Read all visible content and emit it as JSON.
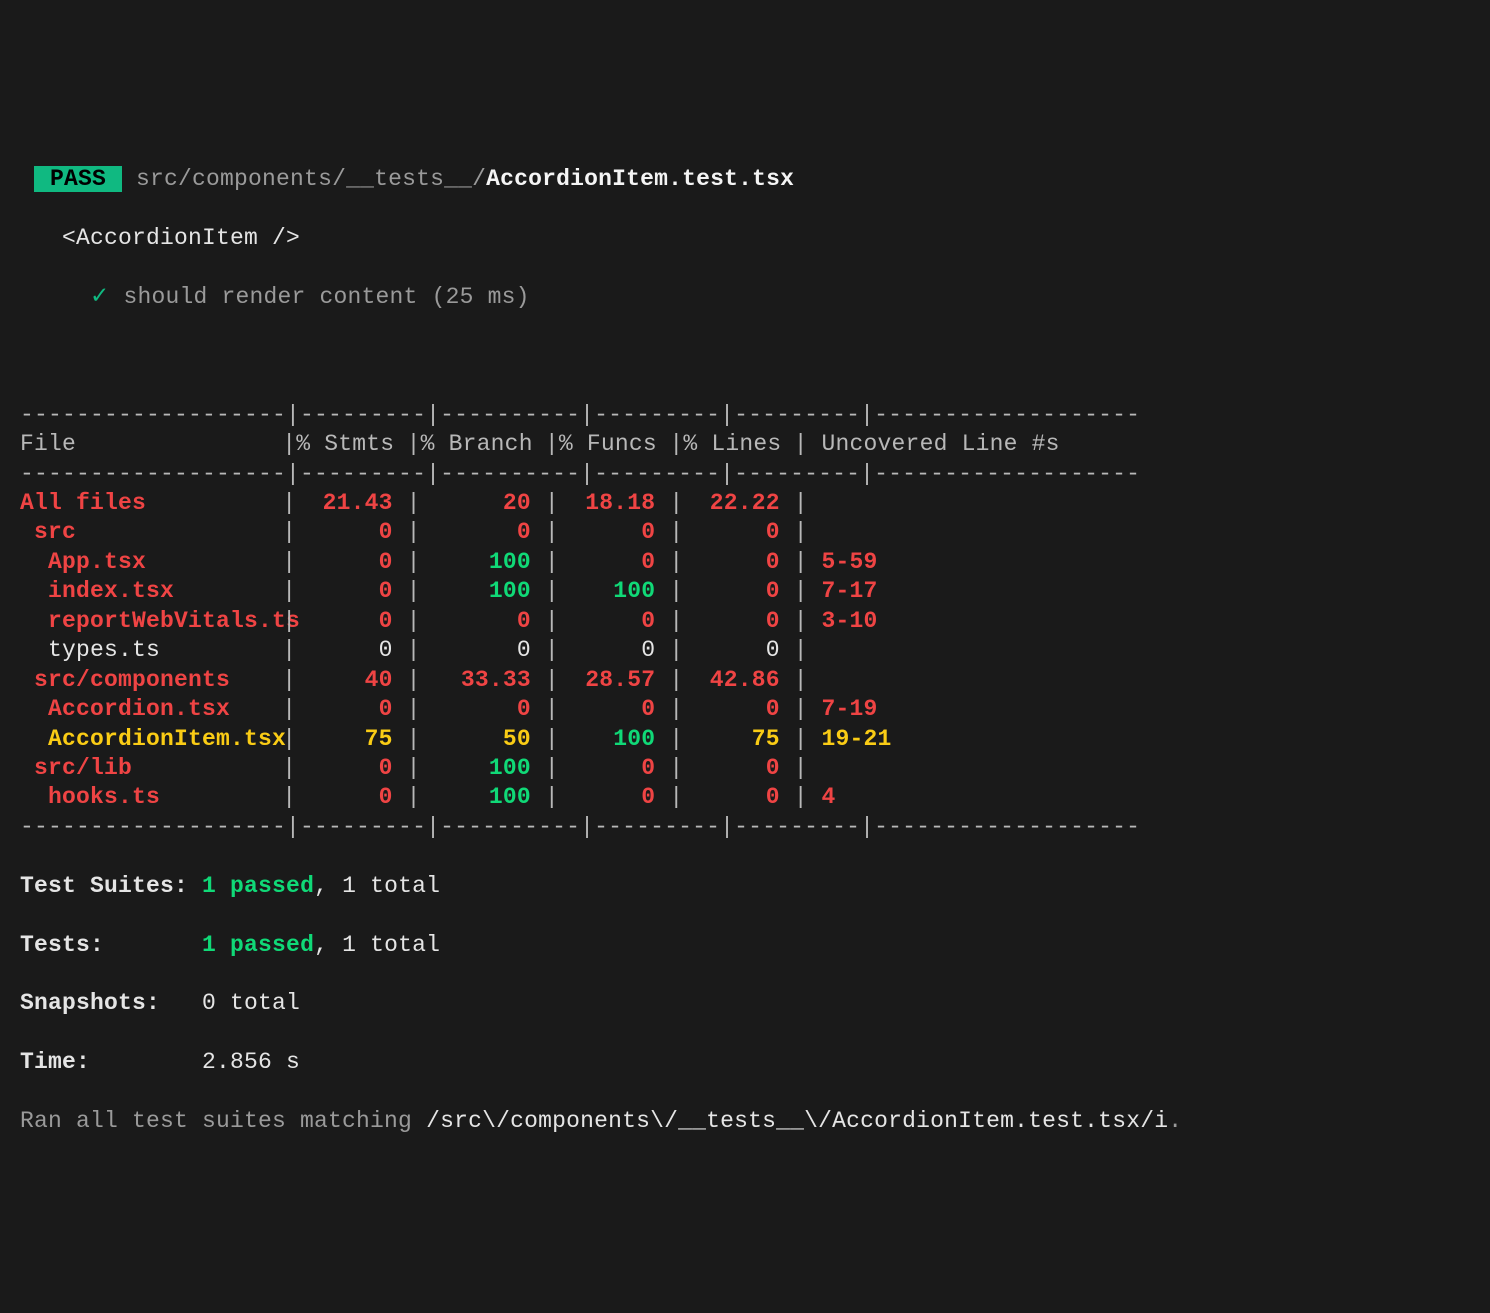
{
  "pass_badge": " PASS ",
  "path_dim": " src/components/__tests__/",
  "path_bright": "AccordionItem.test.tsx",
  "suite_name": "<AccordionItem />",
  "check": "✓",
  "test_desc": "should render content (25 ms)",
  "dash": {
    "file": "-------------------",
    "stmts": "---------",
    "branch": "----------",
    "funcs": "---------",
    "lines": "---------",
    "unc": "-------------------"
  },
  "headers": {
    "file": "File",
    "stmts": "% Stmts",
    "branch": "% Branch",
    "funcs": "% Funcs",
    "lines": "% Lines",
    "unc": "Uncovered Line #s"
  },
  "rows": [
    {
      "file": "All files",
      "indent": "",
      "fileClass": "red-bold",
      "stmts": "21.43",
      "stmtsClass": "red-bold",
      "branch": "20",
      "branchClass": "red-bold",
      "funcs": "18.18",
      "funcsClass": "red-bold",
      "lines": "22.22",
      "linesClass": "red-bold",
      "unc": "",
      "uncClass": "red-bold"
    },
    {
      "file": "src",
      "indent": " ",
      "fileClass": "red-bold",
      "stmts": "0",
      "stmtsClass": "red-bold",
      "branch": "0",
      "branchClass": "red-bold",
      "funcs": "0",
      "funcsClass": "red-bold",
      "lines": "0",
      "linesClass": "red-bold",
      "unc": "",
      "uncClass": "red-bold"
    },
    {
      "file": "App.tsx",
      "indent": "  ",
      "fileClass": "red-bold",
      "stmts": "0",
      "stmtsClass": "red-bold",
      "branch": "100",
      "branchClass": "green-bold",
      "funcs": "0",
      "funcsClass": "red-bold",
      "lines": "0",
      "linesClass": "red-bold",
      "unc": "5-59",
      "uncClass": "red-bold"
    },
    {
      "file": "index.tsx",
      "indent": "  ",
      "fileClass": "red-bold",
      "stmts": "0",
      "stmtsClass": "red-bold",
      "branch": "100",
      "branchClass": "green-bold",
      "funcs": "100",
      "funcsClass": "green-bold",
      "lines": "0",
      "linesClass": "red-bold",
      "unc": "7-17",
      "uncClass": "red-bold"
    },
    {
      "file": "reportWebVitals.ts",
      "indent": "  ",
      "fileClass": "red-bold",
      "stmts": "0",
      "stmtsClass": "red-bold",
      "branch": "0",
      "branchClass": "red-bold",
      "funcs": "0",
      "funcsClass": "red-bold",
      "lines": "0",
      "linesClass": "red-bold",
      "unc": "3-10",
      "uncClass": "red-bold"
    },
    {
      "file": "types.ts",
      "indent": "  ",
      "fileClass": "white",
      "stmts": "0",
      "stmtsClass": "white",
      "branch": "0",
      "branchClass": "white",
      "funcs": "0",
      "funcsClass": "white",
      "lines": "0",
      "linesClass": "white",
      "unc": "",
      "uncClass": "white"
    },
    {
      "file": "src/components",
      "indent": " ",
      "fileClass": "red-bold",
      "stmts": "40",
      "stmtsClass": "red-bold",
      "branch": "33.33",
      "branchClass": "red-bold",
      "funcs": "28.57",
      "funcsClass": "red-bold",
      "lines": "42.86",
      "linesClass": "red-bold",
      "unc": "",
      "uncClass": "red-bold"
    },
    {
      "file": "Accordion.tsx",
      "indent": "  ",
      "fileClass": "red-bold",
      "stmts": "0",
      "stmtsClass": "red-bold",
      "branch": "0",
      "branchClass": "red-bold",
      "funcs": "0",
      "funcsClass": "red-bold",
      "lines": "0",
      "linesClass": "red-bold",
      "unc": "7-19",
      "uncClass": "red-bold"
    },
    {
      "file": "AccordionItem.tsx",
      "indent": "  ",
      "fileClass": "yellow-bold",
      "stmts": "75",
      "stmtsClass": "yellow-bold",
      "branch": "50",
      "branchClass": "yellow-bold",
      "funcs": "100",
      "funcsClass": "green-bold",
      "lines": "75",
      "linesClass": "yellow-bold",
      "unc": "19-21",
      "uncClass": "yellow-bold"
    },
    {
      "file": "src/lib",
      "indent": " ",
      "fileClass": "red-bold",
      "stmts": "0",
      "stmtsClass": "red-bold",
      "branch": "100",
      "branchClass": "green-bold",
      "funcs": "0",
      "funcsClass": "red-bold",
      "lines": "0",
      "linesClass": "red-bold",
      "unc": "",
      "uncClass": "red-bold"
    },
    {
      "file": "hooks.ts",
      "indent": "  ",
      "fileClass": "red-bold",
      "stmts": "0",
      "stmtsClass": "red-bold",
      "branch": "100",
      "branchClass": "green-bold",
      "funcs": "0",
      "funcsClass": "red-bold",
      "lines": "0",
      "linesClass": "red-bold",
      "unc": "4",
      "uncClass": "red-bold"
    }
  ],
  "summary": {
    "suites_label": "Test Suites:",
    "suites_passed": "1 passed",
    "suites_total": ", 1 total",
    "tests_label": "Tests:",
    "tests_passed": "1 passed",
    "tests_total": ", 1 total",
    "snapshots_label": "Snapshots:",
    "snapshots_value": "0 total",
    "time_label": "Time:",
    "time_value": "2.856 s",
    "ran_prefix": "Ran all test suites matching ",
    "ran_pattern": "/src\\/components\\/__tests__\\/AccordionItem.test.tsx/i",
    "ran_suffix": "."
  }
}
